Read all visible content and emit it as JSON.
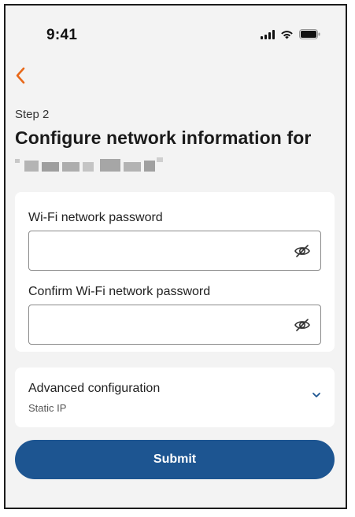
{
  "status_bar": {
    "time": "9:41",
    "icons": [
      "cellular-signal-icon",
      "wifi-icon",
      "battery-icon"
    ]
  },
  "nav": {
    "back_icon": "chevron-left-icon",
    "back_color": "#e8691a"
  },
  "header": {
    "step": "Step 2",
    "title": "Configure network information for",
    "device_name": "(blurred)"
  },
  "passwords": {
    "password_label": "Wi-Fi network password",
    "password_value": "",
    "confirm_label": "Confirm Wi-Fi network password",
    "confirm_value": "",
    "toggle_icon": "eye-slash-icon"
  },
  "advanced": {
    "title": "Advanced configuration",
    "subtitle": "Static IP",
    "expand_icon": "chevron-down-icon",
    "accent": "#1d5591"
  },
  "actions": {
    "submit_label": "Submit",
    "submit_color": "#1d5591"
  }
}
